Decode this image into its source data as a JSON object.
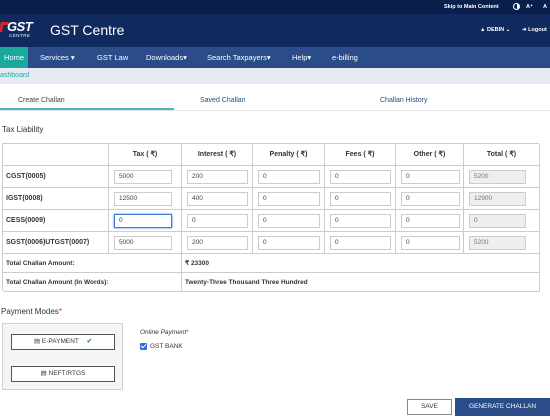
{
  "top_bar": {
    "skip_link": "Skip to Main Content",
    "font_a": "A⁺",
    "font_b": "A"
  },
  "header": {
    "logo_text": "GST",
    "logo_sub": "CENTRE",
    "site_title": "GST Centre",
    "user_menu": "DEBIN ⌄",
    "logout": "Logout"
  },
  "nav": {
    "items": [
      {
        "label": "Home"
      },
      {
        "label": "Services ▾"
      },
      {
        "label": "GST Law"
      },
      {
        "label": "Downloads▾"
      },
      {
        "label": "Search Taxpayers▾"
      },
      {
        "label": "Help▾"
      },
      {
        "label": "e-billing"
      }
    ]
  },
  "breadcrumb": "ashboard",
  "tabs": [
    {
      "label": "Create Challan",
      "active": true
    },
    {
      "label": "Saved Challan",
      "active": false
    },
    {
      "label": "Challan History",
      "active": false
    }
  ],
  "tax_liability": {
    "title": "Tax Liability",
    "columns": [
      "",
      "Tax ( ₹)",
      "Interest ( ₹)",
      "Penalty ( ₹)",
      "Fees ( ₹)",
      "Other ( ₹)",
      "Total ( ₹)"
    ],
    "rows": [
      {
        "label": "CGST(0005)",
        "values": [
          "5000",
          "200",
          "0",
          "0",
          "0"
        ],
        "total": "5200"
      },
      {
        "label": "IGST(0008)",
        "values": [
          "12500",
          "400",
          "0",
          "0",
          "0"
        ],
        "total": "12900"
      },
      {
        "label": "CESS(0009)",
        "values": [
          "0",
          "0",
          "0",
          "0",
          "0"
        ],
        "total": "0"
      },
      {
        "label": "SGST(0006)UTGST(0007)",
        "values": [
          "5000",
          "200",
          "0",
          "0",
          "0"
        ],
        "total": "5200"
      }
    ],
    "total_amount_label": "Total Challan Amount:",
    "total_amount_value": "₹ 23300",
    "total_words_label": "Total Challan Amount (In Words):",
    "total_words_value": "Twenty-Three Thousand Three Hundred"
  },
  "payment_modes": {
    "title": "Payment Modes",
    "required_mark": "*",
    "epayment_label": "E-PAYMENT",
    "epayment_check": "✔",
    "neft_label": "NEFT/RTGS",
    "online_payment_label": "Online Payment",
    "bank_label": "GST BANK",
    "bank_checked": true
  },
  "actions": {
    "save": "SAVE",
    "generate": "GENERATE CHALLAN"
  },
  "colors": {
    "header": "#102a5f",
    "nav": "#2a4c88",
    "active_nav": "#1aa99f",
    "tab_underline": "#4fb0c6",
    "required": "#d7262b"
  }
}
